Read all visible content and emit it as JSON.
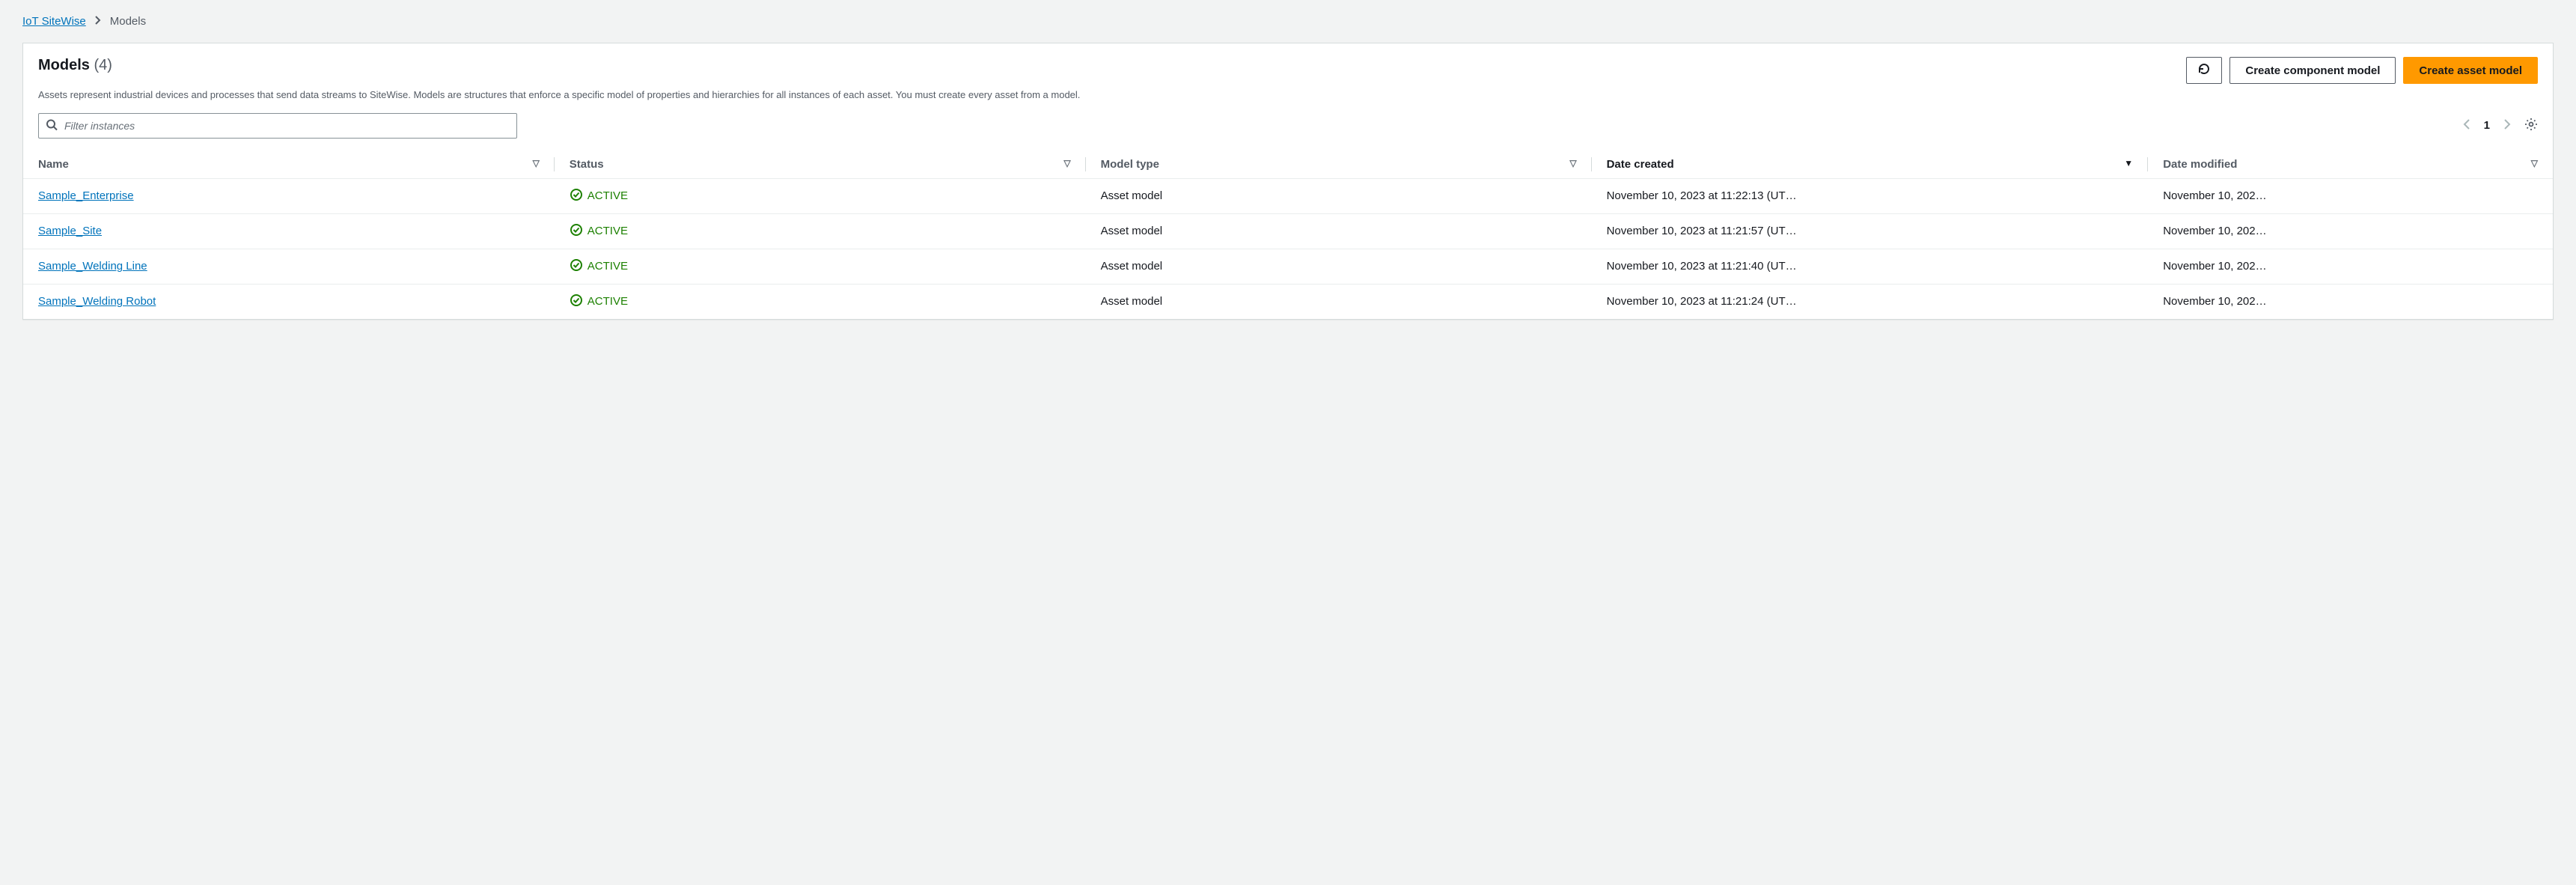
{
  "breadcrumb": {
    "root": "IoT SiteWise",
    "current": "Models"
  },
  "header": {
    "title": "Models",
    "count": "(4)",
    "desc": "Assets represent industrial devices and processes that send data streams to SiteWise. Models are structures that enforce a specific model of properties and hierarchies for all instances of each asset. You must create every asset from a model."
  },
  "actions": {
    "create_component": "Create component model",
    "create_asset": "Create asset model"
  },
  "search": {
    "placeholder": "Filter instances"
  },
  "pager": {
    "page": "1"
  },
  "columns": {
    "name": "Name",
    "status": "Status",
    "model_type": "Model type",
    "date_created": "Date created",
    "date_modified": "Date modified"
  },
  "rows": [
    {
      "name": "Sample_Enterprise",
      "status": "ACTIVE",
      "model_type": "Asset model",
      "date_created": "November 10, 2023 at 11:22:13 (UT…",
      "date_modified": "November 10, 202…"
    },
    {
      "name": "Sample_Site",
      "status": "ACTIVE",
      "model_type": "Asset model",
      "date_created": "November 10, 2023 at 11:21:57 (UT…",
      "date_modified": "November 10, 202…"
    },
    {
      "name": "Sample_Welding Line",
      "status": "ACTIVE",
      "model_type": "Asset model",
      "date_created": "November 10, 2023 at 11:21:40 (UT…",
      "date_modified": "November 10, 202…"
    },
    {
      "name": "Sample_Welding Robot",
      "status": "ACTIVE",
      "model_type": "Asset model",
      "date_created": "November 10, 2023 at 11:21:24 (UT…",
      "date_modified": "November 10, 202…"
    }
  ]
}
